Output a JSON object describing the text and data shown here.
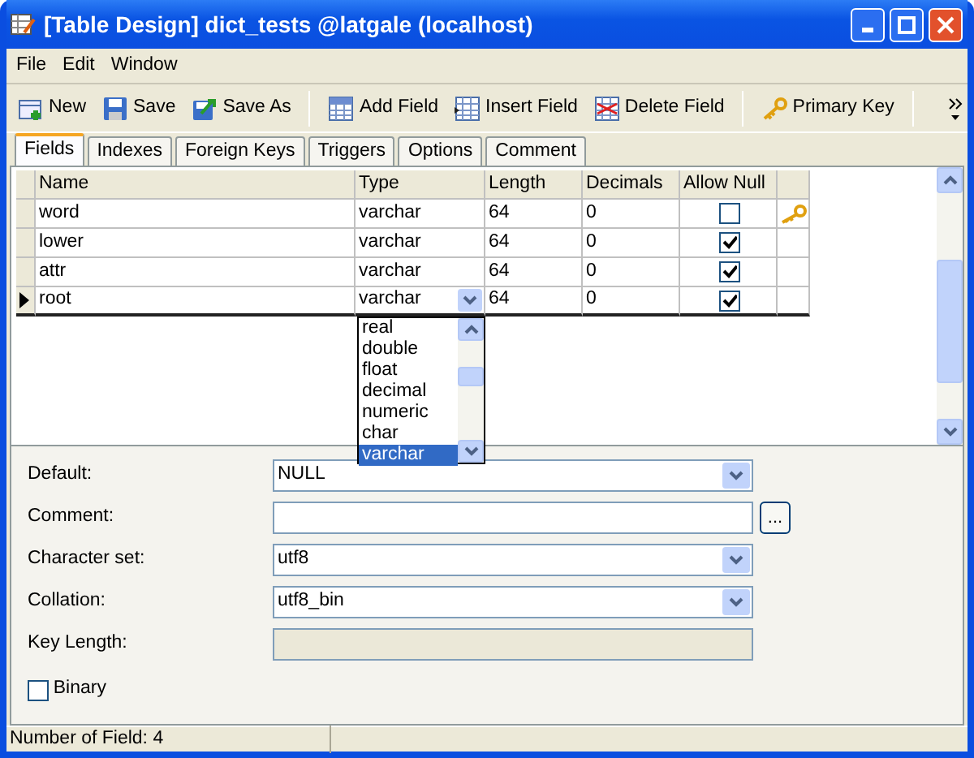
{
  "window": {
    "title": "[Table Design] dict_tests @latgale (localhost)"
  },
  "menu": [
    "File",
    "Edit",
    "Window"
  ],
  "toolbar": [
    [
      {
        "label": "New",
        "kind": "new"
      },
      {
        "label": "Save",
        "kind": "save"
      },
      {
        "label": "Save As",
        "kind": "save-as"
      }
    ],
    [
      {
        "label": "Add Field",
        "kind": "add-field"
      },
      {
        "label": "Insert Field",
        "kind": "insert-field"
      },
      {
        "label": "Delete Field",
        "kind": "delete-field"
      }
    ],
    [
      {
        "label": "Primary Key",
        "kind": "key"
      }
    ]
  ],
  "tabs": [
    {
      "label": "Fields",
      "selected": true
    },
    {
      "label": "Indexes",
      "selected": false
    },
    {
      "label": "Foreign Keys",
      "selected": false
    },
    {
      "label": "Triggers",
      "selected": false
    },
    {
      "label": "Options",
      "selected": false
    },
    {
      "label": "Comment",
      "selected": false
    }
  ],
  "table": {
    "columns": [
      "Name",
      "Type",
      "Length",
      "Decimals",
      "Allow Null"
    ],
    "rows": [
      {
        "name": "word",
        "type": "varchar",
        "length": "64",
        "decimals": "0",
        "allow_null": false,
        "primary_key": true,
        "selected": false
      },
      {
        "name": "lower",
        "type": "varchar",
        "length": "64",
        "decimals": "0",
        "allow_null": true,
        "primary_key": false,
        "selected": false
      },
      {
        "name": "attr",
        "type": "varchar",
        "length": "64",
        "decimals": "0",
        "allow_null": true,
        "primary_key": false,
        "selected": false
      },
      {
        "name": "root",
        "type": "varchar",
        "length": "64",
        "decimals": "0",
        "allow_null": true,
        "primary_key": false,
        "selected": true
      }
    ]
  },
  "type_dropdown": {
    "options": [
      {
        "label": "real",
        "selected": false
      },
      {
        "label": "double",
        "selected": false
      },
      {
        "label": "float",
        "selected": false
      },
      {
        "label": "decimal",
        "selected": false
      },
      {
        "label": "numeric",
        "selected": false
      },
      {
        "label": "char",
        "selected": false
      },
      {
        "label": "varchar",
        "selected": true
      }
    ]
  },
  "properties": [
    {
      "label": "Default:",
      "kind": "combo",
      "value": "NULL"
    },
    {
      "label": "Comment:",
      "kind": "text-button",
      "button": "..."
    },
    {
      "label": "Character set:",
      "kind": "combo",
      "value": "utf8"
    },
    {
      "label": "Collation:",
      "kind": "combo",
      "value": "utf8_bin"
    },
    {
      "label": "Key Length:",
      "kind": "disabled"
    }
  ],
  "binary": {
    "label": "Binary",
    "checked": false
  },
  "status_bar": "Number of Field: 4"
}
